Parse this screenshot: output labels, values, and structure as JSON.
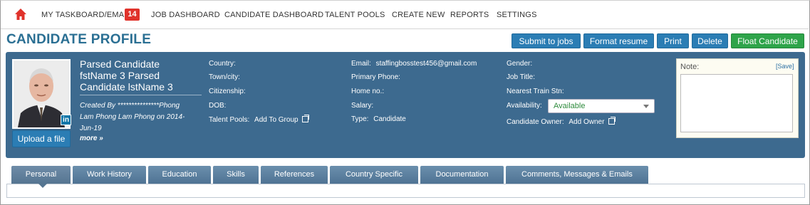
{
  "nav": {
    "items": [
      {
        "label": "MY TASKBOARD/EMAIL"
      },
      {
        "label": "JOB DASHBOARD"
      },
      {
        "label": "CANDIDATE DASHBOARD"
      },
      {
        "label": "TALENT POOLS"
      },
      {
        "label": "CREATE NEW"
      },
      {
        "label": "REPORTS"
      },
      {
        "label": "SETTINGS"
      }
    ],
    "badge": "14",
    "home_icon": "home-icon",
    "accent": "#e0322b"
  },
  "header": {
    "title": "CANDIDATE PROFILE",
    "buttons": {
      "submit": "Submit to jobs",
      "format": "Format resume",
      "print": "Print",
      "delete": "Delete",
      "float": "Float Candidate"
    }
  },
  "profile": {
    "name_lines": [
      "Parsed Candidate",
      "fstName 3 Parsed",
      "Candidate lstName 3"
    ],
    "created_lines": [
      "Created By ***************Phong",
      "Lam Phong Lam Phong on 2014-",
      "Jun-19"
    ],
    "more": "more »",
    "upload": "Upload a file",
    "linkedin": "in",
    "fields": {
      "country": "Country:",
      "town": "Town/city:",
      "citizenship": "Citizenship:",
      "dob": "DOB:",
      "talent_pools": "Talent Pools:",
      "talent_pools_value": "Add To Group",
      "email": "Email:",
      "email_value": "staffingbosstest456@gmail.com",
      "primary_phone": "Primary Phone:",
      "home_no": "Home no.:",
      "salary": "Salary:",
      "type": "Type:",
      "type_value": "Candidate",
      "gender": "Gender:",
      "job_title": "Job Title:",
      "train": "Nearest Train Stn:",
      "availability": "Availability:",
      "availability_value": "Available",
      "owner": "Candidate Owner:",
      "owner_value": "Add Owner"
    },
    "note": {
      "label": "Note:",
      "save": "[Save]"
    },
    "panel_color": "#3d6a8f"
  },
  "tabs": [
    {
      "label": "Personal"
    },
    {
      "label": "Work History"
    },
    {
      "label": "Education"
    },
    {
      "label": "Skills"
    },
    {
      "label": "References"
    },
    {
      "label": "Country Specific"
    },
    {
      "label": "Documentation"
    },
    {
      "label": "Comments, Messages & Emails"
    }
  ]
}
